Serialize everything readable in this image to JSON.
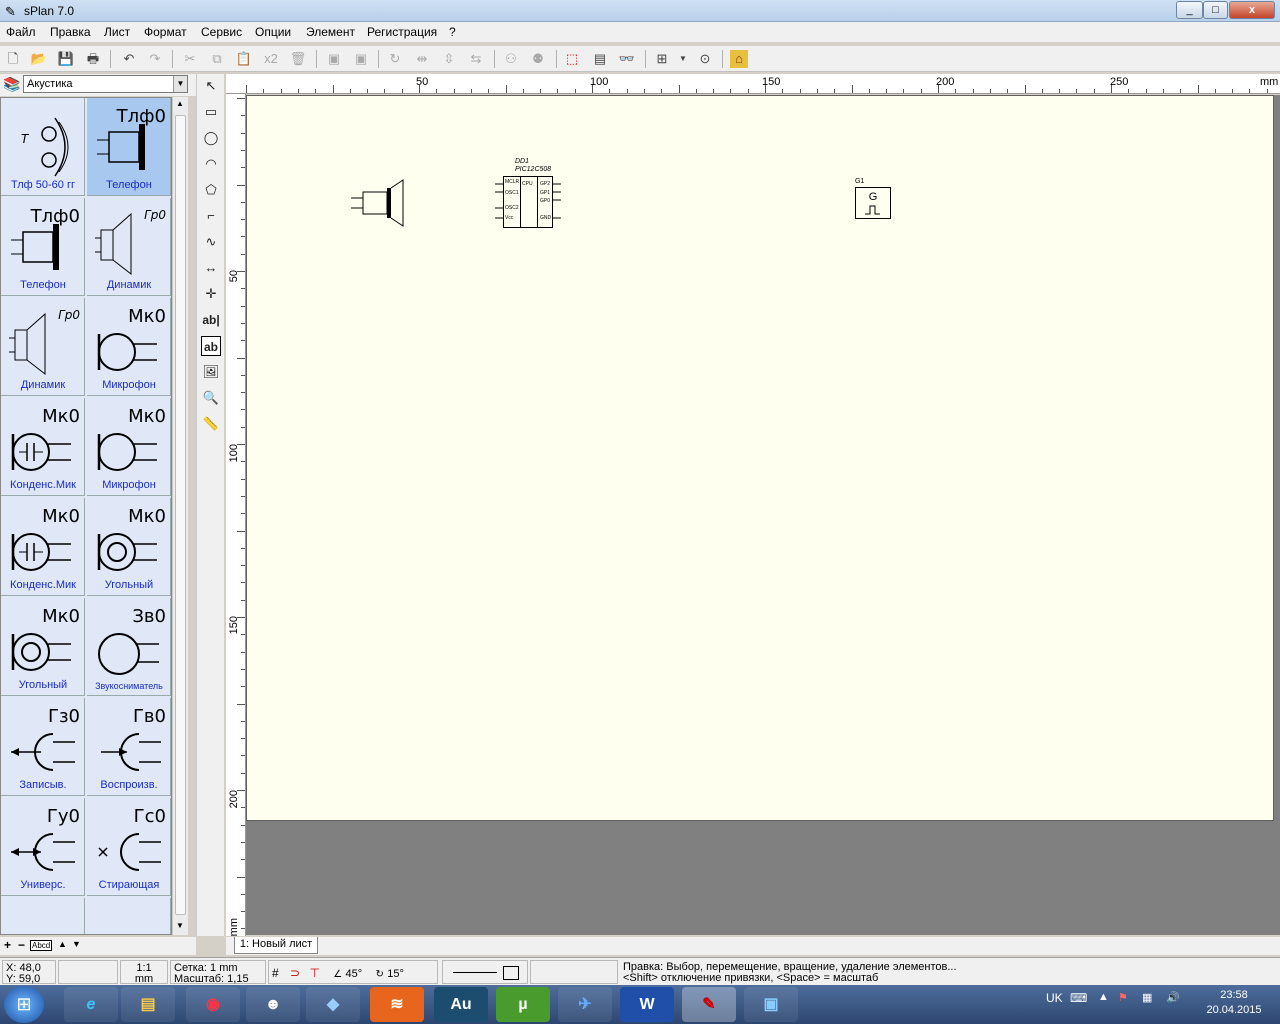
{
  "window": {
    "title": "sPlan 7.0",
    "min": "_",
    "max": "□",
    "close": "x"
  },
  "menu": [
    "Файл",
    "Правка",
    "Лист",
    "Формат",
    "Сервис",
    "Опции",
    "Элемент",
    "Регистрация",
    "?"
  ],
  "toolbar": {
    "copy_count": "x2"
  },
  "library": {
    "selected": "Акустика",
    "items": [
      {
        "desig": "T",
        "italic": true,
        "label": "Тлф 50-60 гг",
        "icon": "headphone-icon"
      },
      {
        "desig": "Тлф0",
        "italic": false,
        "label": "Телефон",
        "icon": "telephone-icon",
        "selected": true
      },
      {
        "desig": "Тлф0",
        "italic": false,
        "label": "Телефон",
        "icon": "telephone-icon"
      },
      {
        "desig": "Гр0",
        "italic": true,
        "label": "Динамик",
        "icon": "speaker-icon"
      },
      {
        "desig": "Гр0",
        "italic": true,
        "label": "Динамик",
        "icon": "speaker-icon"
      },
      {
        "desig": "Мк0",
        "italic": false,
        "label": "Микрофон",
        "icon": "microphone-icon"
      },
      {
        "desig": "Мк0",
        "italic": false,
        "label": "Конденс.Мик",
        "icon": "condenser-mic-icon"
      },
      {
        "desig": "Мк0",
        "italic": false,
        "label": "Микрофон",
        "icon": "microphone-icon"
      },
      {
        "desig": "Мк0",
        "italic": false,
        "label": "Конденс.Мик",
        "icon": "condenser-mic-icon"
      },
      {
        "desig": "Мк0",
        "italic": false,
        "label": "Угольный",
        "icon": "carbon-mic-icon"
      },
      {
        "desig": "Мк0",
        "italic": false,
        "label": "Угольный",
        "icon": "carbon-mic-icon"
      },
      {
        "desig": "Зв0",
        "italic": false,
        "label": "Звукосниматель",
        "icon": "pickup-icon"
      },
      {
        "desig": "Гз0",
        "italic": false,
        "label": "Записыв.",
        "icon": "record-head-icon"
      },
      {
        "desig": "Гв0",
        "italic": false,
        "label": "Воспроизв.",
        "icon": "play-head-icon"
      },
      {
        "desig": "Гу0",
        "italic": false,
        "label": "Универс.",
        "icon": "universal-head-icon"
      },
      {
        "desig": "Гс0",
        "italic": false,
        "label": "Стирающая",
        "icon": "erase-head-icon"
      }
    ],
    "bottom": {
      "plus": "+",
      "minus": "−",
      "abcd": "Abcd",
      "up": "▲",
      "down": "▼"
    }
  },
  "draw_tools": {
    "text_tool": "ab|",
    "textbox_tool": "ab"
  },
  "ruler": {
    "top_labels": [
      "50",
      "100",
      "150",
      "200",
      "250",
      "mm"
    ],
    "left_labels": [
      "50",
      "100",
      "150",
      "200",
      "mm"
    ]
  },
  "schematic": {
    "ic": {
      "ref": "DD1",
      "part": "PIC12C508",
      "left_pins": [
        "MCLR",
        "OSC1",
        "OSC2",
        "Vcc"
      ],
      "core": "CPU",
      "right_pins": [
        "GP2",
        "GP1",
        "GP0",
        "GND"
      ]
    },
    "generator": {
      "ref": "G1",
      "symbol": "G"
    }
  },
  "tabs": {
    "active": "1: Новый лист"
  },
  "status": {
    "x": "X: 48,0",
    "y": "Y: 59,0",
    "scale1": "1:1",
    "scale_unit": "mm",
    "grid": "Сетка: 1 mm",
    "zoom": "Масштаб:  1,15",
    "angle1": "45°",
    "angle2": "15°",
    "hint1": "Правка: Выбор, перемещение, вращение, удаление элементов...",
    "hint2": "<Shift> отключение привязки, <Space> = масштаб"
  },
  "taskbar": {
    "lang": "UK",
    "time": "23:58",
    "date": "20.04.2015",
    "au": "Au",
    "ut": "µ",
    "word": "W"
  }
}
